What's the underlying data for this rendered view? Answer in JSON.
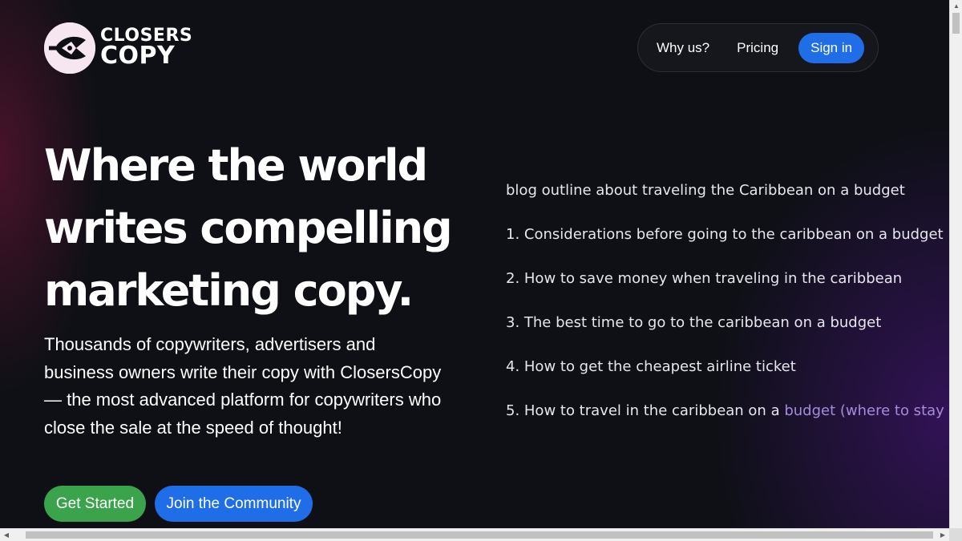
{
  "brand": {
    "line1": "CLOSERS",
    "line2": "COPY",
    "icon": "pen-nib-logo-icon"
  },
  "nav": {
    "why": "Why us?",
    "pricing": "Pricing",
    "signin": "Sign in"
  },
  "hero": {
    "title_line1": "Where the world",
    "title_line2": "writes compelling",
    "title_line3": "marketing copy.",
    "subtitle": "Thousands of copywriters, advertisers and business owners write their copy with ClosersCopy — the most advanced platform for copywriters who close the sale at the speed of thought!",
    "cta_primary": "Get Started",
    "cta_secondary": "Join the Community"
  },
  "demo_output": {
    "prompt": "blog outline about traveling the Caribbean on a budget",
    "items": [
      "1. Considerations before going to the caribbean on a budget",
      "2. How to save money when traveling in the caribbean",
      "3. The best time to go to the caribbean on a budget",
      "4. How to get the cheapest airline ticket"
    ],
    "item5_main": "5. How to travel in the caribbean on a ",
    "item5_fading": "budget (where to stay"
  },
  "colors": {
    "background": "#0e1016",
    "primary_blue": "#1f6ee8",
    "green": "#3aa34c"
  }
}
